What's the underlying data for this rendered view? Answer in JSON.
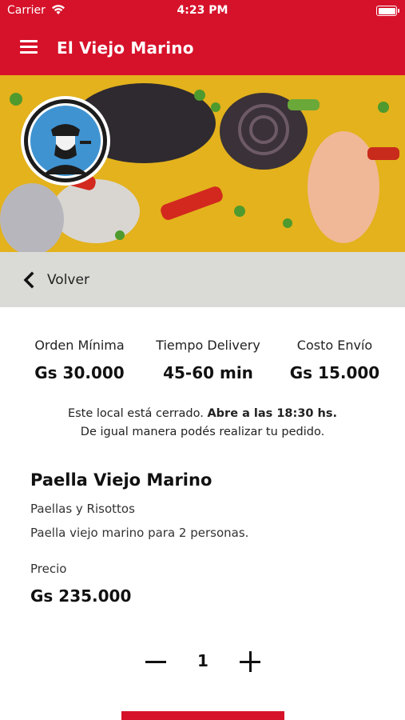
{
  "status_bar": {
    "carrier": "Carrier",
    "time": "4:23 PM"
  },
  "header": {
    "title": "El Viejo Marino",
    "accent_color": "#d6122a"
  },
  "back": {
    "label": "Volver"
  },
  "store_info": [
    {
      "label": "Orden Mínima",
      "value": "Gs 30.000"
    },
    {
      "label": "Tiempo Delivery",
      "value": "45-60 min"
    },
    {
      "label": "Costo Envío",
      "value": "Gs 15.000"
    }
  ],
  "notice": {
    "closed_text": "Este local está cerrado.",
    "opens_text": "Abre a las 18:30 hs.",
    "order_anyway": "De igual manera podés realizar tu pedido."
  },
  "product": {
    "name": "Paella Viejo Marino",
    "category": "Paellas y Risottos",
    "description": "Paella viejo marino para 2 personas.",
    "price_label": "Precio",
    "price": "Gs 235.000"
  },
  "quantity": {
    "value": "1"
  },
  "icons": [
    "wifi-icon",
    "battery-icon",
    "menu-icon",
    "back-chevron-icon",
    "restaurant-logo",
    "minus-icon",
    "plus-icon"
  ]
}
